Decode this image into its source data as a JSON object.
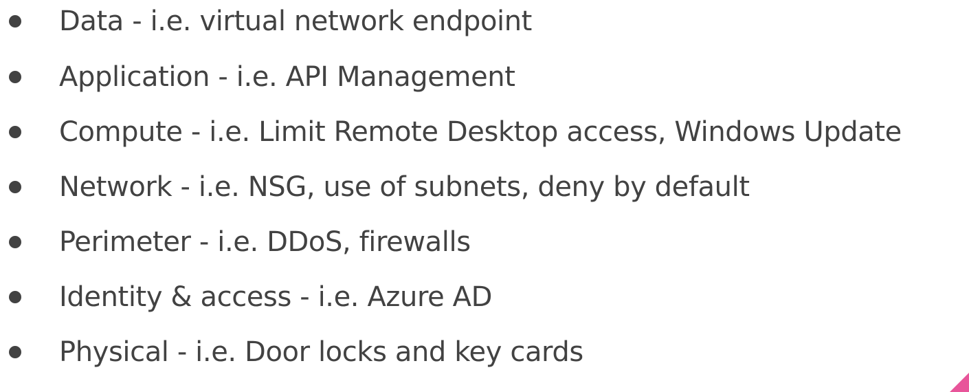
{
  "bullets": [
    "Data - i.e. virtual network endpoint",
    "Application - i.e. API Management",
    "Compute - i.e. Limit Remote Desktop access, Windows Update",
    "Network - i.e. NSG, use of subnets, deny by default",
    "Perimeter - i.e. DDoS, firewalls",
    "Identity & access - i.e. Azure AD",
    "Physical - i.e. Door locks and key cards"
  ],
  "colors": {
    "text": "#424242",
    "bullet": "#424242",
    "accent": "#e8559a",
    "background": "#ffffff"
  }
}
